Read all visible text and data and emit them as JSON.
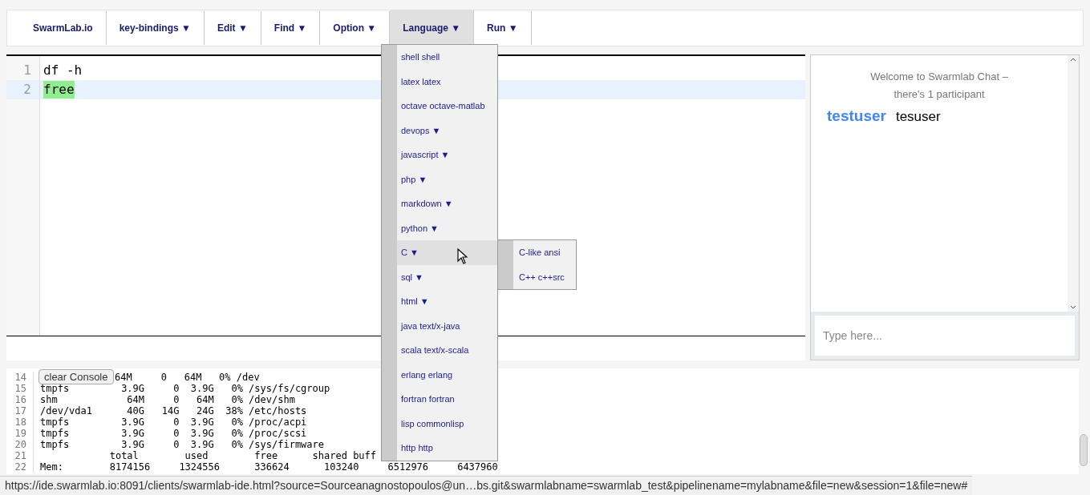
{
  "navbar": {
    "brand": "SwarmLab.io",
    "menus": [
      {
        "label": "key-bindings ▼",
        "selected": false
      },
      {
        "label": "Edit ▼",
        "selected": false
      },
      {
        "label": "Find ▼",
        "selected": false
      },
      {
        "label": "Option ▼",
        "selected": false
      },
      {
        "label": "Language ▼",
        "selected": true
      },
      {
        "label": "Run ▼",
        "selected": false
      }
    ]
  },
  "language_menu": {
    "items": [
      {
        "label": "shell shell",
        "selected": false
      },
      {
        "label": "latex latex",
        "selected": false
      },
      {
        "label": "octave octave-matlab",
        "selected": false
      },
      {
        "label": "devops ▼",
        "selected": false
      },
      {
        "label": "javascript ▼",
        "selected": false
      },
      {
        "label": "php ▼",
        "selected": false
      },
      {
        "label": "markdown ▼",
        "selected": false
      },
      {
        "label": "python ▼",
        "selected": false
      },
      {
        "label": "C ▼",
        "selected": true,
        "submenu": [
          "C-like ansi",
          "C++ c++src"
        ]
      },
      {
        "label": "sql ▼",
        "selected": false
      },
      {
        "label": "html ▼",
        "selected": false
      },
      {
        "label": "java text/x-java",
        "selected": false
      },
      {
        "label": "scala text/x-scala",
        "selected": false
      },
      {
        "label": "erlang erlang",
        "selected": false
      },
      {
        "label": "fortran fortran",
        "selected": false
      },
      {
        "label": "lisp commonlisp",
        "selected": false
      },
      {
        "label": "http http",
        "selected": false
      }
    ]
  },
  "editor": {
    "lines": [
      {
        "number": "1",
        "text": "df -h",
        "active": false,
        "match": false
      },
      {
        "number": "2",
        "text": "free",
        "active": true,
        "match": true
      }
    ]
  },
  "chat": {
    "welcome": "Welcome to Swarmlab Chat –",
    "participants": "there's 1 participant",
    "messages": [
      {
        "user": "testuser",
        "text": "tesuser"
      }
    ],
    "input": {
      "placeholder": "Type here..."
    }
  },
  "console": {
    "clear_button": "clear Console",
    "lines": [
      {
        "number": "14",
        "text": "64M     0   64M   0% /dev"
      },
      {
        "number": "15",
        "text": "tmpfs         3.9G     0  3.9G   0% /sys/fs/cgroup"
      },
      {
        "number": "16",
        "text": "shm            64M     0   64M   0% /dev/shm"
      },
      {
        "number": "17",
        "text": "/dev/vda1      40G   14G   24G  38% /etc/hosts"
      },
      {
        "number": "18",
        "text": "tmpfs         3.9G     0  3.9G   0% /proc/acpi"
      },
      {
        "number": "19",
        "text": "tmpfs         3.9G     0  3.9G   0% /proc/scsi"
      },
      {
        "number": "20",
        "text": "tmpfs         3.9G     0  3.9G   0% /sys/firmware"
      },
      {
        "number": "21",
        "text": "            total        used        free      shared buff"
      },
      {
        "number": "22",
        "text": "Mem:        8174156     1324556      336624      103240     6512976     6437960"
      }
    ]
  },
  "status_bar": "https://ide.swarmlab.io:8091/clients/swarmlab-ide.html?source=Sourceanagnostopoulos@un…bs.git&swarmlabname=swarmlab_test&pipelinename=mylabname&file=new&session=1&file=new#"
}
